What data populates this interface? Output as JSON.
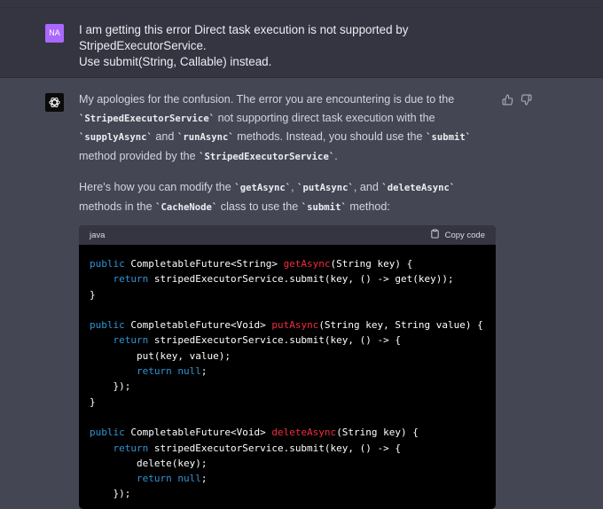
{
  "user_message": {
    "avatar_initials": "NA",
    "text_line1": "I am getting this error Direct task execution is not supported by StripedExecutorService.",
    "text_line2": "Use submit(String, Callable) instead."
  },
  "assistant_message": {
    "para1": {
      "t1": "My apologies for the confusion. The error you are encountering is due to the ",
      "c1": "`StripedExecutorService`",
      "t2": " not supporting direct task execution with the ",
      "c2": "`supplyAsync`",
      "t3": " and ",
      "c3": "`runAsync`",
      "t4": " methods. Instead, you should use the ",
      "c4": "`submit`",
      "t5": " method provided by the ",
      "c5": "`StripedExecutorService`",
      "t6": "."
    },
    "para2": {
      "t1": "Here's how you can modify the ",
      "c1": "`getAsync`",
      "t2": ", ",
      "c2": "`putAsync`",
      "t3": ", and ",
      "c3": "`deleteAsync`",
      "t4": " methods in the ",
      "c4": "`CacheNode`",
      "t5": " class to use the ",
      "c5": "`submit`",
      "t6": " method:"
    }
  },
  "code_block": {
    "language": "java",
    "copy_label": "Copy code",
    "lines": [
      [
        {
          "k": "kw",
          "t": "public"
        },
        {
          "t": " CompletableFuture<String> "
        },
        {
          "k": "fn",
          "t": "getAsync"
        },
        {
          "t": "(String key) {"
        }
      ],
      [
        {
          "t": "    "
        },
        {
          "k": "kw",
          "t": "return"
        },
        {
          "t": " stripedExecutorService.submit(key, () -> get(key));"
        }
      ],
      [
        {
          "t": "}"
        }
      ],
      [
        {
          "t": ""
        }
      ],
      [
        {
          "k": "kw",
          "t": "public"
        },
        {
          "t": " CompletableFuture<Void> "
        },
        {
          "k": "fn",
          "t": "putAsync"
        },
        {
          "t": "(String key, String value) {"
        }
      ],
      [
        {
          "t": "    "
        },
        {
          "k": "kw",
          "t": "return"
        },
        {
          "t": " stripedExecutorService.submit(key, () -> {"
        }
      ],
      [
        {
          "t": "        put(key, value);"
        }
      ],
      [
        {
          "t": "        "
        },
        {
          "k": "kw",
          "t": "return"
        },
        {
          "t": " "
        },
        {
          "k": "kw",
          "t": "null"
        },
        {
          "t": ";"
        }
      ],
      [
        {
          "t": "    });"
        }
      ],
      [
        {
          "t": "}"
        }
      ],
      [
        {
          "t": ""
        }
      ],
      [
        {
          "k": "kw",
          "t": "public"
        },
        {
          "t": " CompletableFuture<Void> "
        },
        {
          "k": "fn",
          "t": "deleteAsync"
        },
        {
          "t": "(String key) {"
        }
      ],
      [
        {
          "t": "    "
        },
        {
          "k": "kw",
          "t": "return"
        },
        {
          "t": " stripedExecutorService.submit(key, () -> {"
        }
      ],
      [
        {
          "t": "        delete(key);"
        }
      ],
      [
        {
          "t": "        "
        },
        {
          "k": "kw",
          "t": "return"
        },
        {
          "t": " "
        },
        {
          "k": "kw",
          "t": "null"
        },
        {
          "t": ";"
        }
      ],
      [
        {
          "t": "    });"
        }
      ]
    ]
  },
  "icons": {
    "assistant_avatar": "openai-logo-icon",
    "thumbs_up": "thumbs-up-icon",
    "thumbs_down": "thumbs-down-icon",
    "copy": "clipboard-icon"
  },
  "colors": {
    "user_avatar": "#ab68ff",
    "keyword": "#2e95d3",
    "function_name": "#f22c3d"
  }
}
